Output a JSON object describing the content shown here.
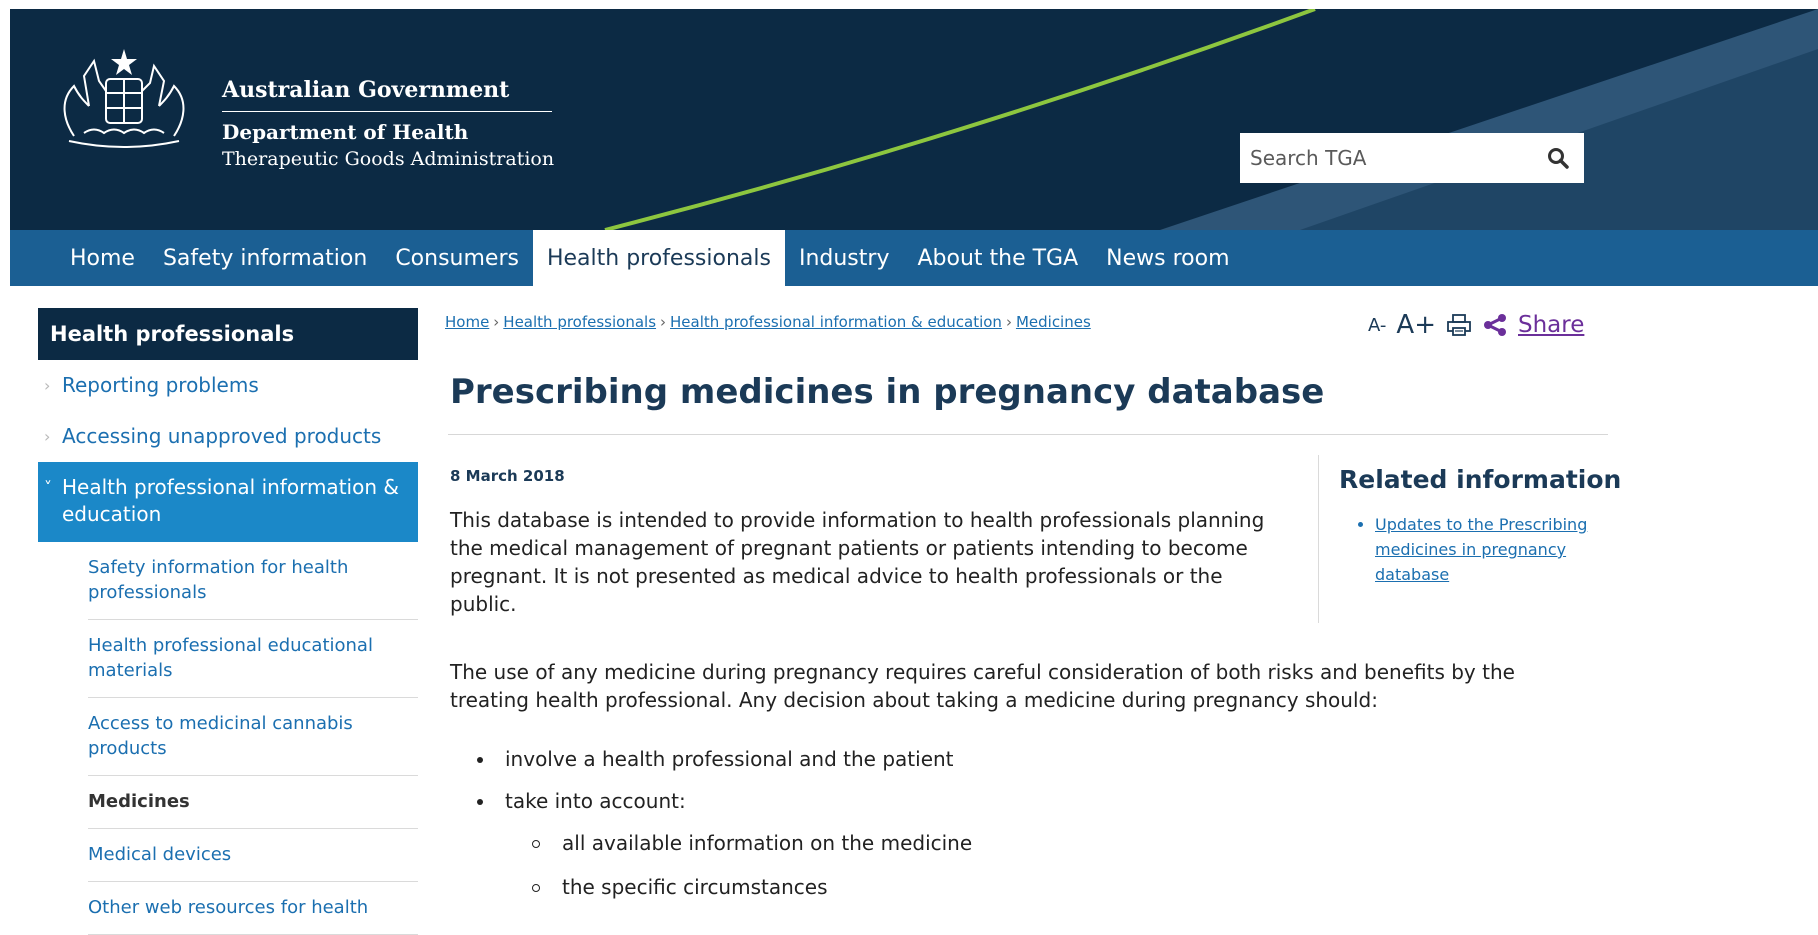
{
  "header": {
    "gov_name": "Australian Government",
    "dept_name": "Department of Health",
    "agency_name": "Therapeutic Goods Administration",
    "search_placeholder": "Search TGA",
    "colors": {
      "dark": "#0c2a44",
      "mid": "#2e5577",
      "accent_line": "#8dc63f"
    }
  },
  "nav": {
    "items": [
      {
        "label": "Home"
      },
      {
        "label": "Safety information"
      },
      {
        "label": "Consumers"
      },
      {
        "label": "Health professionals",
        "active": true
      },
      {
        "label": "Industry"
      },
      {
        "label": "About the TGA"
      },
      {
        "label": "News room"
      }
    ],
    "color": "#1b5f93"
  },
  "sidebar": {
    "heading": "Health professionals",
    "items": [
      {
        "label": "Reporting problems"
      },
      {
        "label": "Accessing unapproved products"
      },
      {
        "label": "Health professional information & education",
        "expanded": true
      }
    ],
    "subitems": [
      {
        "label": "Safety information for health professionals"
      },
      {
        "label": "Health professional educational materials"
      },
      {
        "label": "Access to medicinal cannabis products"
      },
      {
        "label": "Medicines",
        "current": true
      },
      {
        "label": "Medical devices"
      },
      {
        "label": "Other web resources for health"
      }
    ]
  },
  "breadcrumb": {
    "items": [
      "Home",
      "Health professionals",
      "Health professional information & education",
      "Medicines"
    ],
    "separator": "›"
  },
  "tools": {
    "decrease_label": "A-",
    "increase_label": "A+",
    "print_icon": "print-icon",
    "share_icon": "share-icon",
    "share_label": "Share"
  },
  "main": {
    "title": "Prescribing medicines in pregnancy database",
    "date": "8 March 2018",
    "para1": "This database is intended to provide information to health professionals planning the medical management of pregnant patients or patients intending to become pregnant. It is not presented as medical advice to health professionals or the public.",
    "para2": "The use of any medicine during pregnancy requires careful consideration of both risks and benefits by the treating health professional. Any decision about taking a medicine during pregnancy should:",
    "bullets": [
      "involve a health professional and the patient",
      "take into account:"
    ],
    "subbullets": [
      "all available information on the medicine",
      "the specific circumstances"
    ]
  },
  "related": {
    "heading": "Related information",
    "links": [
      "Updates to the Prescribing medicines in pregnancy database"
    ]
  }
}
